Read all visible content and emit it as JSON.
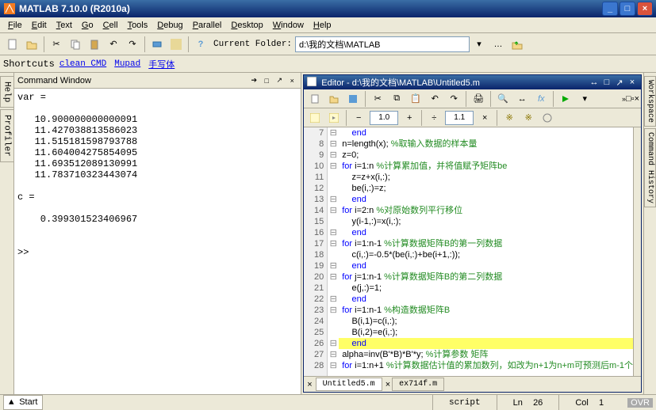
{
  "window": {
    "title": "MATLAB  7.10.0 (R2010a)"
  },
  "menus": [
    "File",
    "Edit",
    "Text",
    "Go",
    "Cell",
    "Tools",
    "Debug",
    "Parallel",
    "Desktop",
    "Window",
    "Help"
  ],
  "toolbar": {
    "folder_label": "Current Folder:",
    "folder_value": "d:\\我的文档\\MATLAB"
  },
  "shortcuts": {
    "label": "Shortcuts",
    "items": [
      "clean CMD",
      "Mupad",
      "手写体"
    ]
  },
  "left_tabs": [
    "Help",
    "Profiler"
  ],
  "cmd": {
    "title": "Command Window",
    "lines": [
      "var =",
      "",
      "   10.900000000000091",
      "   11.427038813586023",
      "   11.515181598793788",
      "   11.604004275854095",
      "   11.693512089130991",
      "   11.783710323443074",
      "",
      "c =",
      "",
      "    0.399301523406967",
      "",
      "",
      ">> "
    ]
  },
  "editor": {
    "title": "Editor - d:\\我的文档\\MATLAB\\Untitled5.m",
    "zoom1": "1.0",
    "zoom2": "1.1",
    "lines": [
      {
        "n": "7",
        "fold": "-",
        "type": "end",
        "text": "end"
      },
      {
        "n": "8",
        "fold": "-",
        "type": "code",
        "text": "n=length(x);",
        "cm": " %取输入数据的样本量"
      },
      {
        "n": "9",
        "fold": "-",
        "type": "code",
        "text": "z=0;"
      },
      {
        "n": "10",
        "fold": "-",
        "type": "for",
        "text": "for i=1:n ",
        "cm": "%计算累加值，并将值赋予矩阵be"
      },
      {
        "n": "11",
        "fold": "",
        "type": "code",
        "text": "    z=z+x(i,:);"
      },
      {
        "n": "12",
        "fold": "",
        "type": "code",
        "text": "    be(i,:)=z;"
      },
      {
        "n": "13",
        "fold": "-",
        "type": "end",
        "text": "end"
      },
      {
        "n": "14",
        "fold": "-",
        "type": "for",
        "text": "for i=2:n ",
        "cm": "%对原始数列平行移位"
      },
      {
        "n": "15",
        "fold": "",
        "type": "code",
        "text": "    y(i-1,:)=x(i,:);"
      },
      {
        "n": "16",
        "fold": "-",
        "type": "end",
        "text": "end"
      },
      {
        "n": "17",
        "fold": "-",
        "type": "for",
        "text": "for i=1:n-1 ",
        "cm": "%计算数据矩阵B的第一列数据"
      },
      {
        "n": "18",
        "fold": "",
        "type": "code",
        "text": "    c(i,:)=-0.5*(be(i,:)+be(i+1,:));"
      },
      {
        "n": "19",
        "fold": "-",
        "type": "end",
        "text": "end"
      },
      {
        "n": "20",
        "fold": "-",
        "type": "for",
        "text": "for j=1:n-1 ",
        "cm": "%计算数据矩阵B的第二列数据"
      },
      {
        "n": "21",
        "fold": "",
        "type": "code",
        "text": "    e(j,:)=1;"
      },
      {
        "n": "22",
        "fold": "-",
        "type": "end",
        "text": "end"
      },
      {
        "n": "23",
        "fold": "-",
        "type": "for",
        "text": "for i=1:n-1 ",
        "cm": "%构造数据矩阵B"
      },
      {
        "n": "24",
        "fold": "",
        "type": "code",
        "text": "    B(i,1)=c(i,:);"
      },
      {
        "n": "25",
        "fold": "",
        "type": "code",
        "text": "    B(i,2)=e(i,:);"
      },
      {
        "n": "26",
        "fold": "-",
        "type": "end",
        "text": "end",
        "hl": true
      },
      {
        "n": "27",
        "fold": "-",
        "type": "code",
        "text": "alpha=inv(B'*B)*B'*y; ",
        "cm": "%计算参数 矩阵"
      },
      {
        "n": "28",
        "fold": "-",
        "type": "for",
        "text": "for i=1:n+1 ",
        "cm": "%计算数据估计值的累加数列，如改为n+1为n+m可预测后m-1个"
      }
    ],
    "tabs": [
      {
        "name": "Untitled5.m",
        "active": true
      },
      {
        "name": "ex714f.m",
        "active": false
      }
    ]
  },
  "right_tabs": [
    "Workspace",
    "Command History"
  ],
  "status": {
    "start": "Start",
    "script": "script",
    "ln_label": "Ln",
    "ln": "26",
    "col_label": "Col",
    "col": "1",
    "ovr": "OVR"
  }
}
